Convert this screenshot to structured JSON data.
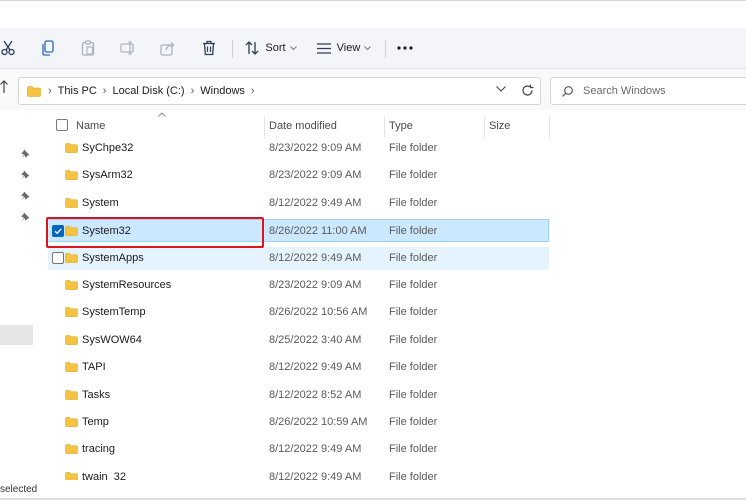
{
  "toolbar": {
    "sort_label": "Sort",
    "view_label": "View"
  },
  "address": {
    "crumbs": [
      "This PC",
      "Local Disk (C:)",
      "Windows"
    ]
  },
  "search": {
    "placeholder": "Search Windows"
  },
  "columns": {
    "name": "Name",
    "date": "Date modified",
    "type": "Type",
    "size": "Size"
  },
  "files": [
    {
      "name": "SyChpe32",
      "date": "8/23/2022 9:09 AM",
      "type": "File folder",
      "state": "normal"
    },
    {
      "name": "SysArm32",
      "date": "8/23/2022 9:09 AM",
      "type": "File folder",
      "state": "normal"
    },
    {
      "name": "System",
      "date": "8/12/2022 9:49 AM",
      "type": "File folder",
      "state": "normal"
    },
    {
      "name": "System32",
      "date": "8/26/2022 11:00 AM",
      "type": "File folder",
      "state": "selected"
    },
    {
      "name": "SystemApps",
      "date": "8/12/2022 9:49 AM",
      "type": "File folder",
      "state": "hover"
    },
    {
      "name": "SystemResources",
      "date": "8/23/2022 9:09 AM",
      "type": "File folder",
      "state": "normal"
    },
    {
      "name": "SystemTemp",
      "date": "8/26/2022 10:56 AM",
      "type": "File folder",
      "state": "normal"
    },
    {
      "name": "SysWOW64",
      "date": "8/25/2022 3:40 AM",
      "type": "File folder",
      "state": "normal"
    },
    {
      "name": "TAPI",
      "date": "8/12/2022 9:49 AM",
      "type": "File folder",
      "state": "normal"
    },
    {
      "name": "Tasks",
      "date": "8/12/2022 8:52 AM",
      "type": "File folder",
      "state": "normal"
    },
    {
      "name": "Temp",
      "date": "8/26/2022 10:59 AM",
      "type": "File folder",
      "state": "normal"
    },
    {
      "name": "tracing",
      "date": "8/12/2022 9:49 AM",
      "type": "File folder",
      "state": "normal"
    },
    {
      "name": "twain_32",
      "date": "8/12/2022 9:49 AM",
      "type": "File folder",
      "state": "normal"
    }
  ],
  "status": {
    "text": "selected"
  },
  "colors": {
    "selection_bg": "#cce8ff",
    "hover_bg": "#e5f3ff",
    "accent": "#0067c0",
    "folder": "#f5c342",
    "highlight_box": "#e0141c"
  },
  "icons": {
    "cut": "scissors-icon",
    "copy": "copy-icon",
    "paste": "paste-icon",
    "rename": "rename-icon",
    "share": "share-icon",
    "delete": "trash-icon",
    "sort": "sort-icon",
    "view": "view-icon",
    "more": "more-icon",
    "folder": "folder-icon",
    "search": "search-icon",
    "refresh": "refresh-icon",
    "pin": "pin-icon"
  }
}
